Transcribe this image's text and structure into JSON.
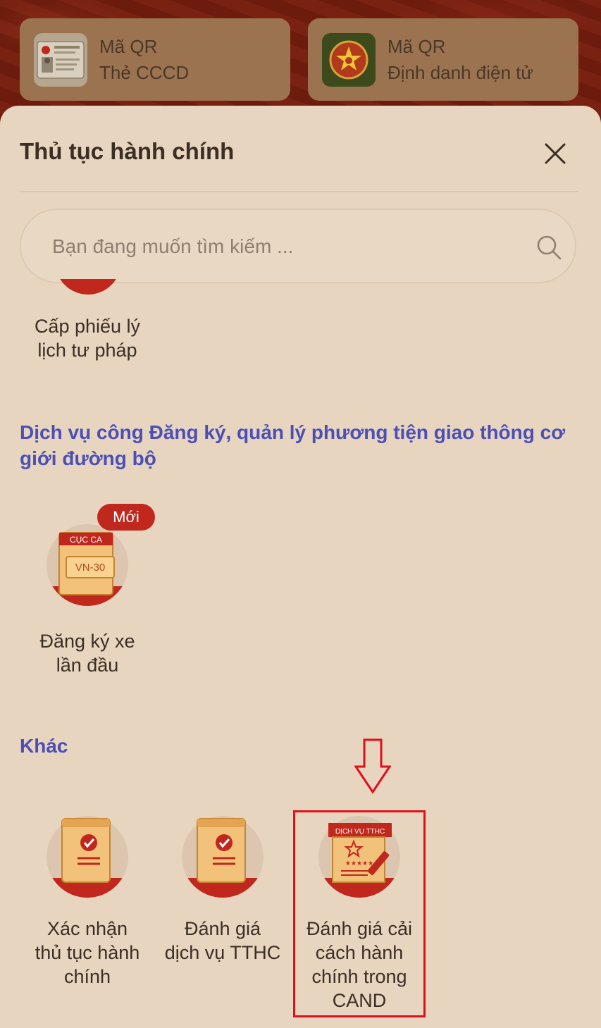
{
  "qr_cards": [
    {
      "line1": "Mã QR",
      "line2": "Thẻ CCCD",
      "icon": "id-card-icon"
    },
    {
      "line1": "Mã QR",
      "line2": "Định danh điện tử",
      "icon": "police-emblem-icon"
    }
  ],
  "sheet": {
    "title": "Thủ tục hành chính",
    "close_icon": "close-icon"
  },
  "search": {
    "placeholder": "Bạn đang muốn tìm kiếm ...",
    "icon": "search-icon"
  },
  "services_top": {
    "criminal_record": {
      "line1": "Cấp phiếu lý",
      "line2": "lịch tư pháp"
    }
  },
  "section_vehicle": {
    "title_line1": "Dịch vụ công Đăng ký, quản lý phương tiện giao thông cơ",
    "title_line2": "giới đường bộ",
    "items": [
      {
        "line1": "Đăng ký xe",
        "line2": "lần đầu",
        "badge": "Mới",
        "plate_header": "CỤC CA",
        "plate_text": "VN-30"
      }
    ]
  },
  "section_other": {
    "title": "Khác",
    "items": [
      {
        "lines": [
          "Xác nhận",
          "thủ tục hành",
          "chính"
        ]
      },
      {
        "lines": [
          "Đánh giá",
          "dịch vụ TTHC"
        ]
      },
      {
        "lines": [
          "Đánh giá cải",
          "cách hành",
          "chính trong",
          "CAND"
        ],
        "icon_header": "DỊCH VỤ TTHC"
      }
    ]
  },
  "colors": {
    "section_title": "#4b4fb6",
    "accent_red": "#c0281e",
    "sheet_bg": "#e7d5c0",
    "highlight": "#e0101a"
  }
}
